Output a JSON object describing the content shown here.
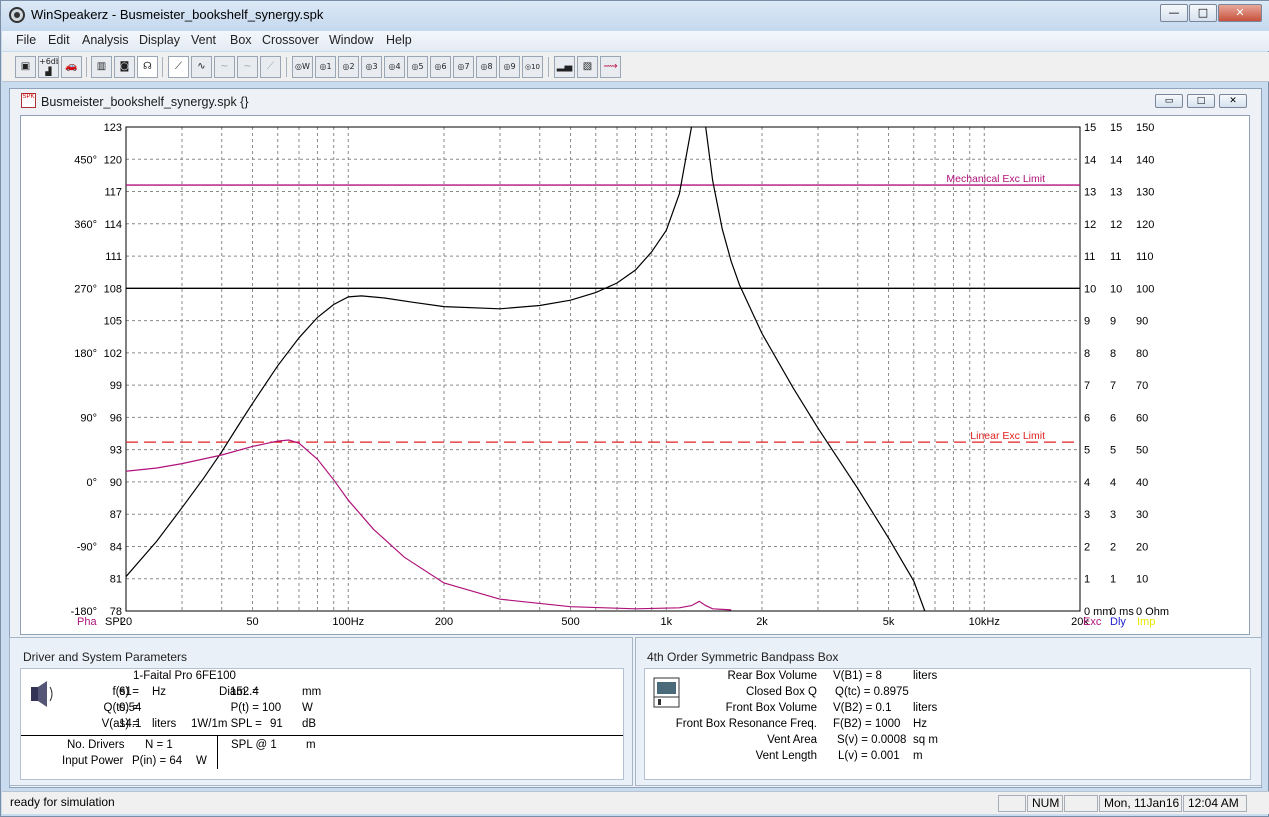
{
  "app": {
    "title": "WinSpeakerz - Busmeister_bookshelf_synergy.spk",
    "window_buttons": {
      "minimize": "—",
      "maximize": "□",
      "close": "✕"
    }
  },
  "menu": [
    "File",
    "Edit",
    "Analysis",
    "Display",
    "Vent",
    "Box",
    "Crossover",
    "Window",
    "Help"
  ],
  "toolbar": {
    "numbered_buttons": [
      "W",
      "1",
      "2",
      "3",
      "4",
      "5",
      "6",
      "7",
      "8",
      "9",
      "10"
    ],
    "step_label": "+6db"
  },
  "document": {
    "title": "Busmeister_bookshelf_synergy.spk {}",
    "icon_text": "SPK"
  },
  "chart_data": {
    "type": "line",
    "x_scale": "log",
    "xlim": [
      20,
      20000
    ],
    "x_tick_labels": [
      "20",
      "50",
      "100Hz",
      "200",
      "500",
      "1k",
      "2k",
      "5k",
      "10kHz",
      "20k"
    ],
    "x_tick_values": [
      20,
      50,
      100,
      200,
      500,
      1000,
      2000,
      5000,
      10000,
      20000
    ],
    "spl_ticks": [
      "123",
      "120",
      "117",
      "114",
      "111",
      "108",
      "105",
      "102",
      "99",
      "96",
      "93",
      "90",
      "87",
      "84",
      "81",
      "78"
    ],
    "phase_ticks": [
      {
        "label": "450°",
        "spl": 120
      },
      {
        "label": "360°",
        "spl": 114
      },
      {
        "label": "270°",
        "spl": 108
      },
      {
        "label": "180°",
        "spl": 102
      },
      {
        "label": "90°",
        "spl": 96
      },
      {
        "label": "0°",
        "spl": 90
      },
      {
        "label": "-90°",
        "spl": 84
      },
      {
        "label": "-180°",
        "spl": 78
      }
    ],
    "ylim": [
      78,
      123
    ],
    "right_axis_rows": [
      {
        "spl": 123,
        "a": "15",
        "b": "15",
        "c": "150"
      },
      {
        "spl": 120,
        "a": "14",
        "b": "14",
        "c": "140"
      },
      {
        "spl": 117,
        "a": "13",
        "b": "13",
        "c": "130"
      },
      {
        "spl": 114,
        "a": "12",
        "b": "12",
        "c": "120"
      },
      {
        "spl": 111,
        "a": "11",
        "b": "11",
        "c": "110"
      },
      {
        "spl": 108,
        "a": "10",
        "b": "10",
        "c": "100"
      },
      {
        "spl": 105,
        "a": "9",
        "b": "9",
        "c": "90"
      },
      {
        "spl": 102,
        "a": "8",
        "b": "8",
        "c": "80"
      },
      {
        "spl": 99,
        "a": "7",
        "b": "7",
        "c": "70"
      },
      {
        "spl": 96,
        "a": "6",
        "b": "6",
        "c": "60"
      },
      {
        "spl": 93,
        "a": "5",
        "b": "5",
        "c": "50"
      },
      {
        "spl": 90,
        "a": "4",
        "b": "4",
        "c": "40"
      },
      {
        "spl": 87,
        "a": "3",
        "b": "3",
        "c": "30"
      },
      {
        "spl": 84,
        "a": "2",
        "b": "2",
        "c": "20"
      },
      {
        "spl": 81,
        "a": "1",
        "b": "1",
        "c": "10"
      },
      {
        "spl": 78,
        "a": "0 mm",
        "b": "0 ms",
        "c": "0 Ohm"
      }
    ],
    "bottom_left_labels": [
      {
        "text": "Pha",
        "color": "#b0127a"
      },
      {
        "text": "SPL",
        "color": "#000000"
      }
    ],
    "bottom_right_labels": [
      {
        "text": "Exc",
        "color": "#b0127a"
      },
      {
        "text": "Dly",
        "color": "#2020d0"
      },
      {
        "text": "Imp",
        "color": "#e8e800"
      }
    ],
    "reference_lines": [
      {
        "label": "Mechanical Exc Limit",
        "spl": 117.6,
        "style": "solid",
        "color": "#b0127a"
      },
      {
        "label": "Linear Exc Limit",
        "spl": 93.7,
        "style": "dashed",
        "color": "#e02020"
      },
      {
        "label": "",
        "spl": 108,
        "style": "solid",
        "color": "#000000"
      }
    ],
    "series": [
      {
        "color": "#000000",
        "points": [
          [
            20,
            81.2
          ],
          [
            25,
            84.5
          ],
          [
            30,
            87.6
          ],
          [
            35,
            90.3
          ],
          [
            40,
            92.8
          ],
          [
            45,
            95.2
          ],
          [
            50,
            97.3
          ],
          [
            60,
            100.8
          ],
          [
            70,
            103.4
          ],
          [
            80,
            105.3
          ],
          [
            90,
            106.5
          ],
          [
            100,
            107.2
          ],
          [
            110,
            107.3
          ],
          [
            130,
            107.1
          ],
          [
            160,
            106.7
          ],
          [
            200,
            106.3
          ],
          [
            300,
            106.1
          ],
          [
            400,
            106.4
          ],
          [
            500,
            106.9
          ],
          [
            600,
            107.6
          ],
          [
            700,
            108.5
          ],
          [
            800,
            109.7
          ],
          [
            900,
            111.4
          ],
          [
            1000,
            113.4
          ],
          [
            1100,
            116.8
          ],
          [
            1200,
            123
          ]
        ]
      },
      {
        "color": "#000000",
        "points": [
          [
            1330,
            123
          ],
          [
            1400,
            118
          ],
          [
            1500,
            113.5
          ],
          [
            1600,
            110.5
          ],
          [
            1700,
            108.3
          ],
          [
            2000,
            103.8
          ],
          [
            2500,
            98.8
          ],
          [
            3000,
            95
          ],
          [
            4000,
            89.4
          ],
          [
            5000,
            84.8
          ],
          [
            6000,
            80.8
          ],
          [
            6500,
            78
          ]
        ]
      },
      {
        "color": "#b0127a",
        "points": [
          [
            20,
            91
          ],
          [
            25,
            91.3
          ],
          [
            30,
            91.7
          ],
          [
            40,
            92.5
          ],
          [
            50,
            93.3
          ],
          [
            60,
            93.8
          ],
          [
            65,
            93.9
          ],
          [
            70,
            93.6
          ],
          [
            80,
            92.1
          ],
          [
            90,
            90.2
          ],
          [
            100,
            88.3
          ],
          [
            120,
            85.6
          ],
          [
            150,
            83
          ],
          [
            200,
            80.6
          ],
          [
            300,
            79.1
          ],
          [
            500,
            78.4
          ],
          [
            800,
            78.2
          ],
          [
            1100,
            78.3
          ],
          [
            1200,
            78.5
          ],
          [
            1270,
            78.9
          ],
          [
            1330,
            78.5
          ],
          [
            1400,
            78.2
          ],
          [
            1600,
            78.1
          ]
        ]
      }
    ]
  },
  "driver_panel": {
    "title": "Driver and System Parameters",
    "driver_name": "1-Faital Pro 6FE100",
    "rows": [
      {
        "label": "f(s) =",
        "value": "61",
        "unit": "Hz",
        "label2": "Diam. =",
        "value2": "152.4",
        "unit2": "mm"
      },
      {
        "label": "Q(ts) =",
        "value": "0.54",
        "unit": "",
        "label2": "P(t) =",
        "value2": "100",
        "unit2": "W"
      },
      {
        "label": "V(as) =",
        "value": "14.1",
        "unit": "liters",
        "label2": "1W/1m SPL =",
        "value2": "91",
        "unit2": "dB"
      }
    ],
    "no_drivers_label": "No. Drivers",
    "no_drivers_value": "N = 1",
    "input_power_label": "Input Power",
    "input_power_value": "P(in) = 64",
    "input_power_unit": "W",
    "spl_at_label": "SPL @ 1",
    "spl_at_unit": "m"
  },
  "box_panel": {
    "title": "4th Order Symmetric Bandpass Box",
    "rows": [
      {
        "label": "Rear Box Volume",
        "value": "V(B1) = 8",
        "unit": "liters"
      },
      {
        "label": "Closed Box Q",
        "value": "Q(tc) = 0.8975",
        "unit": ""
      },
      {
        "label": "Front Box Volume",
        "value": "V(B2) = 0.1",
        "unit": "liters"
      },
      {
        "label": "Front Box Resonance Freq.",
        "value": "F(B2) = 1000",
        "unit": "Hz"
      },
      {
        "label": "Vent Area",
        "value": "S(v) = 0.0008",
        "unit": "sq m"
      },
      {
        "label": "Vent Length",
        "value": "L(v) = 0.001",
        "unit": "m"
      }
    ]
  },
  "status": {
    "message": "ready for simulation",
    "num": "NUM",
    "date": "Mon, 11Jan16",
    "time": "12:04  AM"
  }
}
